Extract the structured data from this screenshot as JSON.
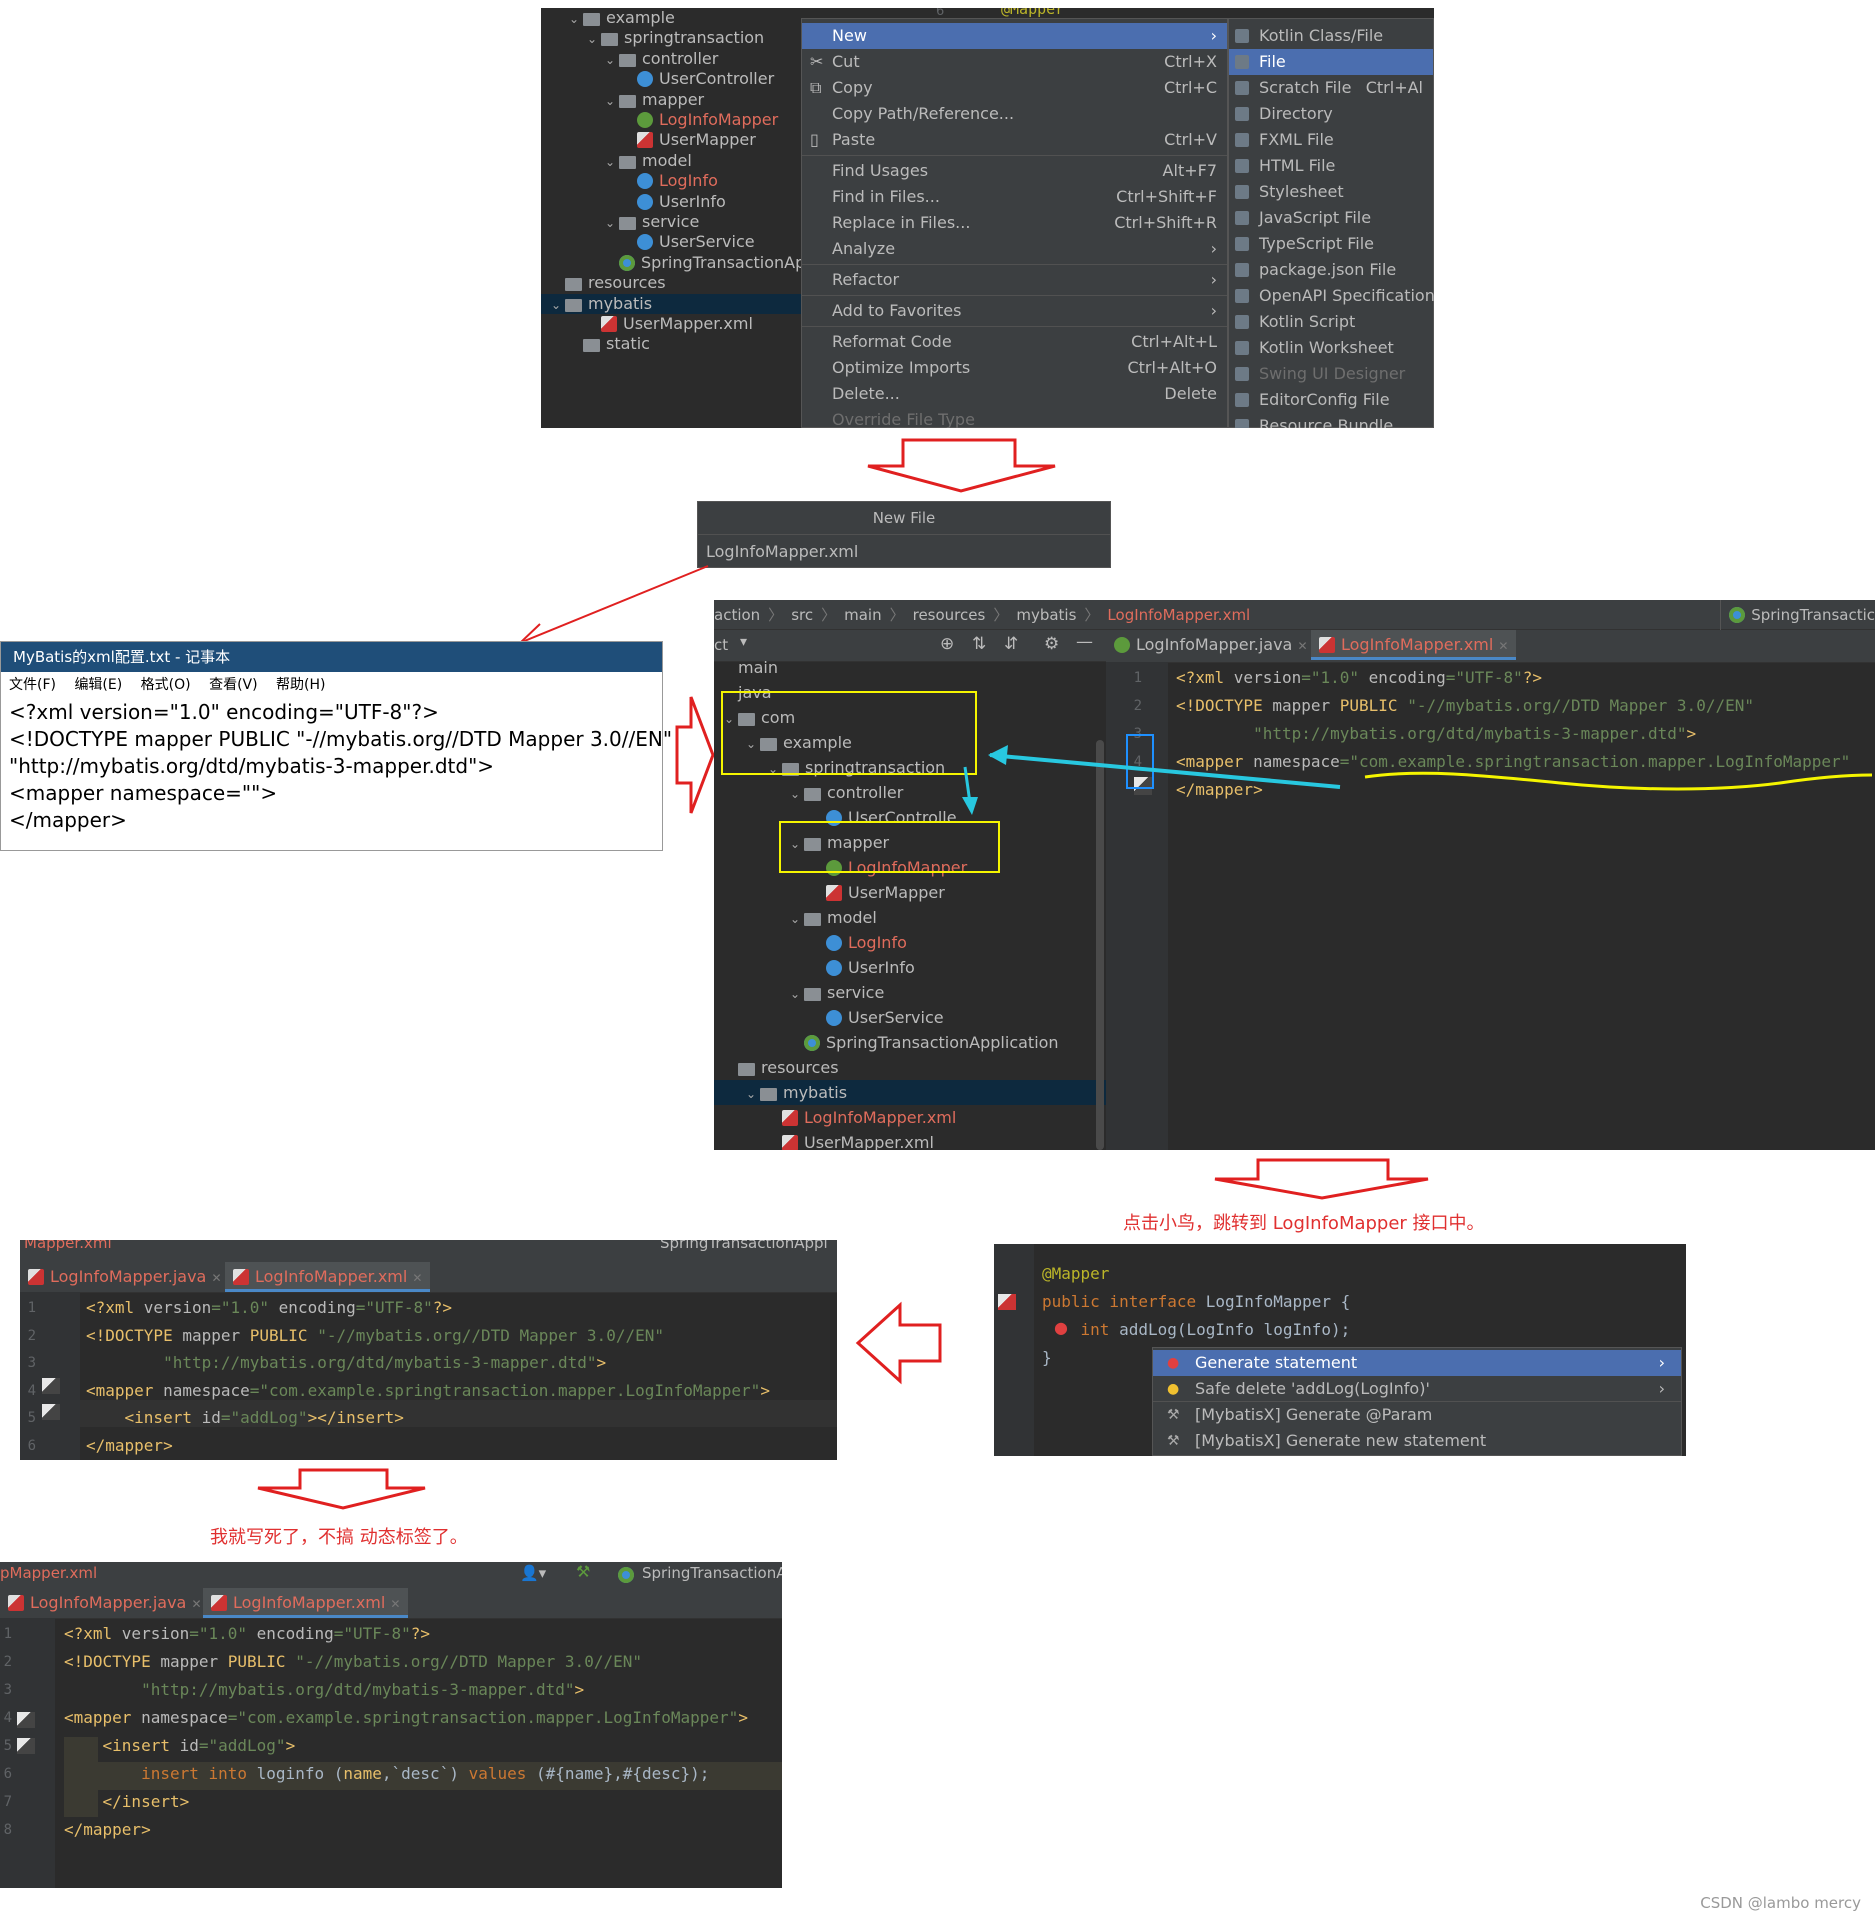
{
  "panel1": {
    "tree": [
      {
        "label": "example",
        "icon": "folder-icon",
        "depth": 1,
        "chev": "⌄"
      },
      {
        "label": "springtransaction",
        "icon": "folder-icon",
        "depth": 2,
        "chev": "⌄"
      },
      {
        "label": "controller",
        "icon": "folder-icon",
        "depth": 3,
        "chev": "⌄"
      },
      {
        "label": "UserController",
        "icon": "class-icon",
        "depth": 4,
        "chev": ""
      },
      {
        "label": "mapper",
        "icon": "folder-icon",
        "depth": 3,
        "chev": "⌄"
      },
      {
        "label": "LogInfoMapper",
        "icon": "interface-icon",
        "depth": 4,
        "chev": "",
        "red": true
      },
      {
        "label": "UserMapper",
        "icon": "mybatis-bird-icon",
        "depth": 4,
        "chev": ""
      },
      {
        "label": "model",
        "icon": "folder-icon",
        "depth": 3,
        "chev": "⌄"
      },
      {
        "label": "LogInfo",
        "icon": "class-icon",
        "depth": 4,
        "chev": "",
        "red": true
      },
      {
        "label": "UserInfo",
        "icon": "class-icon",
        "depth": 4,
        "chev": ""
      },
      {
        "label": "service",
        "icon": "folder-icon",
        "depth": 3,
        "chev": "⌄"
      },
      {
        "label": "UserService",
        "icon": "class-icon",
        "depth": 4,
        "chev": ""
      },
      {
        "label": "SpringTransactionAp",
        "icon": "spring-app-icon",
        "depth": 3,
        "chev": ""
      },
      {
        "label": "resources",
        "icon": "folder-icon",
        "depth": 0,
        "chev": ""
      },
      {
        "label": "mybatis",
        "icon": "folder-icon",
        "depth": 0,
        "chev": "⌄",
        "selected": true
      },
      {
        "label": "UserMapper.xml",
        "icon": "mybatis-bird-icon",
        "depth": 2,
        "chev": ""
      },
      {
        "label": "static",
        "icon": "folder-icon",
        "depth": 1,
        "chev": ""
      }
    ],
    "gutter_line": "6",
    "annotation": "@Mapper",
    "context_menu": [
      {
        "label": "New",
        "shortcut": "",
        "arrow": "›",
        "hi": true
      },
      {
        "label": "Cut",
        "shortcut": "Ctrl+X",
        "icon": "cut-icon"
      },
      {
        "label": "Copy",
        "shortcut": "Ctrl+C",
        "icon": "copy-icon"
      },
      {
        "label": "Copy Path/Reference...",
        "shortcut": ""
      },
      {
        "label": "Paste",
        "shortcut": "Ctrl+V",
        "icon": "paste-icon"
      },
      {
        "sep": true
      },
      {
        "label": "Find Usages",
        "shortcut": "Alt+F7"
      },
      {
        "label": "Find in Files...",
        "shortcut": "Ctrl+Shift+F"
      },
      {
        "label": "Replace in Files...",
        "shortcut": "Ctrl+Shift+R"
      },
      {
        "label": "Analyze",
        "shortcut": "",
        "arrow": "›"
      },
      {
        "sep": true
      },
      {
        "label": "Refactor",
        "shortcut": "",
        "arrow": "›"
      },
      {
        "sep": true
      },
      {
        "label": "Add to Favorites",
        "shortcut": "",
        "arrow": "›"
      },
      {
        "sep": true
      },
      {
        "label": "Reformat Code",
        "shortcut": "Ctrl+Alt+L"
      },
      {
        "label": "Optimize Imports",
        "shortcut": "Ctrl+Alt+O"
      },
      {
        "label": "Delete...",
        "shortcut": "Delete"
      },
      {
        "label": "Override File Type",
        "shortcut": "",
        "dis": true
      }
    ],
    "submenu": [
      {
        "label": "Kotlin Class/File",
        "shortcut": ""
      },
      {
        "label": "File",
        "shortcut": "",
        "hi": true
      },
      {
        "label": "Scratch File",
        "shortcut": "Ctrl+Al"
      },
      {
        "label": "Directory",
        "shortcut": ""
      },
      {
        "label": "FXML File",
        "shortcut": ""
      },
      {
        "label": "HTML File",
        "shortcut": ""
      },
      {
        "label": "Stylesheet",
        "shortcut": ""
      },
      {
        "label": "JavaScript File",
        "shortcut": ""
      },
      {
        "label": "TypeScript File",
        "shortcut": ""
      },
      {
        "label": "package.json File",
        "shortcut": ""
      },
      {
        "label": "OpenAPI Specification",
        "shortcut": ""
      },
      {
        "label": "Kotlin Script",
        "shortcut": ""
      },
      {
        "label": "Kotlin Worksheet",
        "shortcut": ""
      },
      {
        "label": "Swing UI Designer",
        "shortcut": "",
        "dis": true
      },
      {
        "label": "EditorConfig File",
        "shortcut": ""
      },
      {
        "label": "Resource Bundle",
        "shortcut": ""
      }
    ]
  },
  "new_file_dialog": {
    "title": "New File",
    "value": "LogInfoMapper.xml"
  },
  "notepad": {
    "title": "MyBatis的xml配置.txt - 记事本",
    "menu": [
      "文件(F)",
      "编辑(E)",
      "格式(O)",
      "查看(V)",
      "帮助(H)"
    ],
    "lines": [
      "<?xml version=\"1.0\" encoding=\"UTF-8\"?>",
      "<!DOCTYPE mapper PUBLIC \"-//mybatis.org//DTD Mapper 3.0//EN\"",
      "\"http://mybatis.org/dtd/mybatis-3-mapper.dtd\">",
      "<mapper namespace=\"\">",
      "</mapper>"
    ]
  },
  "panel2": {
    "breadcrumbs": [
      "action",
      "src",
      "main",
      "resources",
      "mybatis",
      "LogInfoMapper.xml"
    ],
    "run_config": "SpringTransactic",
    "project_label": "ct",
    "tabs": [
      "LogInfoMapper.java",
      "LogInfoMapper.xml"
    ],
    "tree": [
      {
        "label": "main",
        "depth": 0,
        "chev": ""
      },
      {
        "label": "java",
        "depth": 0,
        "chev": ""
      },
      {
        "label": "com",
        "depth": 0,
        "chev": "⌄",
        "icon": "folder-icon"
      },
      {
        "label": "example",
        "depth": 1,
        "chev": "⌄",
        "icon": "folder-icon"
      },
      {
        "label": "springtransaction",
        "depth": 2,
        "chev": "⌄",
        "icon": "folder-icon"
      },
      {
        "label": "controller",
        "depth": 3,
        "chev": "⌄",
        "icon": "folder-icon"
      },
      {
        "label": "UserControlle",
        "depth": 4,
        "chev": "",
        "icon": "class-icon"
      },
      {
        "label": "mapper",
        "depth": 3,
        "chev": "⌄",
        "icon": "folder-icon"
      },
      {
        "label": "LogInfoMapper",
        "depth": 4,
        "chev": "",
        "icon": "interface-icon",
        "red": true
      },
      {
        "label": "UserMapper",
        "depth": 4,
        "chev": "",
        "icon": "mybatis-bird-icon"
      },
      {
        "label": "model",
        "depth": 3,
        "chev": "⌄",
        "icon": "folder-icon"
      },
      {
        "label": "LogInfo",
        "depth": 4,
        "chev": "",
        "icon": "class-icon",
        "red": true
      },
      {
        "label": "UserInfo",
        "depth": 4,
        "chev": "",
        "icon": "class-icon"
      },
      {
        "label": "service",
        "depth": 3,
        "chev": "⌄",
        "icon": "folder-icon"
      },
      {
        "label": "UserService",
        "depth": 4,
        "chev": "",
        "icon": "class-icon"
      },
      {
        "label": "SpringTransactionApplication",
        "depth": 3,
        "chev": "",
        "icon": "spring-app-icon"
      },
      {
        "label": "resources",
        "depth": 0,
        "chev": "",
        "icon": "folder-icon"
      },
      {
        "label": "mybatis",
        "depth": 1,
        "chev": "⌄",
        "icon": "folder-icon",
        "selected": true
      },
      {
        "label": "LogInfoMapper.xml",
        "depth": 2,
        "chev": "",
        "icon": "mybatis-bird-icon",
        "red": true
      },
      {
        "label": "UserMapper.xml",
        "depth": 2,
        "chev": "",
        "icon": "mybatis-bird-icon"
      }
    ],
    "line_numbers": [
      "1",
      "2",
      "3",
      "4",
      "5"
    ],
    "code": [
      [
        {
          "t": "<?xml ",
          "c": "tag"
        },
        {
          "t": "version",
          "c": "attr"
        },
        {
          "t": "=\"1.0\" ",
          "c": "str"
        },
        {
          "t": "encoding",
          "c": "attr"
        },
        {
          "t": "=\"UTF-8\"",
          "c": "str"
        },
        {
          "t": "?>",
          "c": "tag"
        }
      ],
      [
        {
          "t": "<!DOCTYPE ",
          "c": "tag"
        },
        {
          "t": "mapper ",
          "c": "attr"
        },
        {
          "t": "PUBLIC ",
          "c": "tag"
        },
        {
          "t": "\"-//mybatis.org//DTD Mapper 3.0//EN\"",
          "c": "str"
        }
      ],
      [
        {
          "t": "        \"http://mybatis.org/dtd/mybatis-3-mapper.dtd\"",
          "c": "str"
        },
        {
          "t": ">",
          "c": "tag"
        }
      ],
      [
        {
          "t": "<mapper ",
          "c": "tag"
        },
        {
          "t": "namespace",
          "c": "attr"
        },
        {
          "t": "=\"com.example.springtransaction.mapper.LogInfoMapper\"",
          "c": "str"
        }
      ],
      [
        {
          "t": "</mapper>",
          "c": "tag"
        }
      ]
    ]
  },
  "caption1": "点击小鸟，跳转到 LogInfoMapper 接口中。",
  "panel3": {
    "code": [
      [
        {
          "t": "@Mapper",
          "c": "ann"
        }
      ],
      [
        {
          "t": "public interface ",
          "c": "kw"
        },
        {
          "t": "LogInfoMapper {",
          "c": "plain"
        }
      ],
      [
        {
          "t": "    int ",
          "c": "kw"
        },
        {
          "t": "addLog",
          "c": "plain"
        },
        {
          "t": "(LogInfo logInfo);",
          "c": "plain"
        }
      ],
      [
        {
          "t": "}",
          "c": "plain"
        }
      ]
    ],
    "popup": [
      {
        "label": "Generate statement",
        "arrow": "›",
        "hi": true,
        "icon": "error-bulb-icon"
      },
      {
        "label": "Safe delete 'addLog(LogInfo)'",
        "arrow": "›",
        "icon": "bulb-icon"
      },
      {
        "label": "[MybatisX] Generate @Param",
        "arrow": "",
        "icon": "mybatisx-icon"
      },
      {
        "label": "[MybatisX] Generate new statement",
        "arrow": "",
        "icon": "mybatisx-icon"
      }
    ]
  },
  "panel4": {
    "breadcrumb": "Mapper.xml",
    "run_config": "SpringTransactionAppl",
    "tabs": [
      "LogInfoMapper.java",
      "LogInfoMapper.xml"
    ],
    "line_numbers": [
      "1",
      "2",
      "3",
      "4",
      "5",
      "6"
    ],
    "code": [
      [
        {
          "t": "<?xml ",
          "c": "tag"
        },
        {
          "t": "version",
          "c": "attr"
        },
        {
          "t": "=\"1.0\" ",
          "c": "str"
        },
        {
          "t": "encoding",
          "c": "attr"
        },
        {
          "t": "=\"UTF-8\"",
          "c": "str"
        },
        {
          "t": "?>",
          "c": "tag"
        }
      ],
      [
        {
          "t": "<!DOCTYPE ",
          "c": "tag"
        },
        {
          "t": "mapper ",
          "c": "attr"
        },
        {
          "t": "PUBLIC ",
          "c": "tag"
        },
        {
          "t": "\"-//mybatis.org//DTD Mapper 3.0//EN\"",
          "c": "str"
        }
      ],
      [
        {
          "t": "        \"http://mybatis.org/dtd/mybatis-3-mapper.dtd\"",
          "c": "str"
        },
        {
          "t": ">",
          "c": "tag"
        }
      ],
      [
        {
          "t": "<mapper ",
          "c": "tag"
        },
        {
          "t": "namespace",
          "c": "attr"
        },
        {
          "t": "=\"com.example.springtransaction.mapper.LogInfoMapper\"",
          "c": "str"
        },
        {
          "t": ">",
          "c": "tag"
        }
      ],
      [
        {
          "t": "    <insert ",
          "c": "tag"
        },
        {
          "t": "id",
          "c": "attr"
        },
        {
          "t": "=\"addLog\"",
          "c": "str"
        },
        {
          "t": "></insert>",
          "c": "tag"
        }
      ],
      [
        {
          "t": "</mapper>",
          "c": "tag"
        }
      ]
    ]
  },
  "caption2": "我就写死了，不搞 动态标签了。",
  "panel5": {
    "breadcrumb": "pMapper.xml",
    "run_config": "SpringTransactionA",
    "tabs": [
      "LogInfoMapper.java",
      "LogInfoMapper.xml"
    ],
    "line_numbers": [
      "1",
      "2",
      "3",
      "4",
      "5",
      "6",
      "7",
      "8"
    ],
    "code": [
      [
        {
          "t": "<?xml ",
          "c": "tag"
        },
        {
          "t": "version",
          "c": "attr"
        },
        {
          "t": "=\"1.0\" ",
          "c": "str"
        },
        {
          "t": "encoding",
          "c": "attr"
        },
        {
          "t": "=\"UTF-8\"",
          "c": "str"
        },
        {
          "t": "?>",
          "c": "tag"
        }
      ],
      [
        {
          "t": "<!DOCTYPE ",
          "c": "tag"
        },
        {
          "t": "mapper ",
          "c": "attr"
        },
        {
          "t": "PUBLIC ",
          "c": "tag"
        },
        {
          "t": "\"-//mybatis.org//DTD Mapper 3.0//EN\"",
          "c": "str"
        }
      ],
      [
        {
          "t": "        \"http://mybatis.org/dtd/mybatis-3-mapper.dtd\"",
          "c": "str"
        },
        {
          "t": ">",
          "c": "tag"
        }
      ],
      [
        {
          "t": "<mapper ",
          "c": "tag"
        },
        {
          "t": "namespace",
          "c": "attr"
        },
        {
          "t": "=\"com.example.springtransaction.mapper.LogInfoMapper\"",
          "c": "str"
        },
        {
          "t": ">",
          "c": "tag"
        }
      ],
      [
        {
          "t": "    <insert ",
          "c": "tag"
        },
        {
          "t": "id",
          "c": "attr"
        },
        {
          "t": "=\"addLog\"",
          "c": "str"
        },
        {
          "t": ">",
          "c": "tag"
        }
      ],
      [
        {
          "t": "        insert into ",
          "c": "kw"
        },
        {
          "t": "loginfo ",
          "c": "plain"
        },
        {
          "t": "(",
          "c": "plain"
        },
        {
          "t": "name",
          "c": "tag"
        },
        {
          "t": ",`desc`) ",
          "c": "plain"
        },
        {
          "t": "values ",
          "c": "kw"
        },
        {
          "t": "(#{name},#{desc});",
          "c": "plain"
        }
      ],
      [
        {
          "t": "    </insert>",
          "c": "tag"
        }
      ],
      [
        {
          "t": "</mapper>",
          "c": "tag"
        }
      ]
    ]
  },
  "watermark": "CSDN @lambo mercy",
  "colors": {
    "arrow_red": "#e02020",
    "highlight_yellow": "#f5f500",
    "cyan": "#28c8e0"
  }
}
